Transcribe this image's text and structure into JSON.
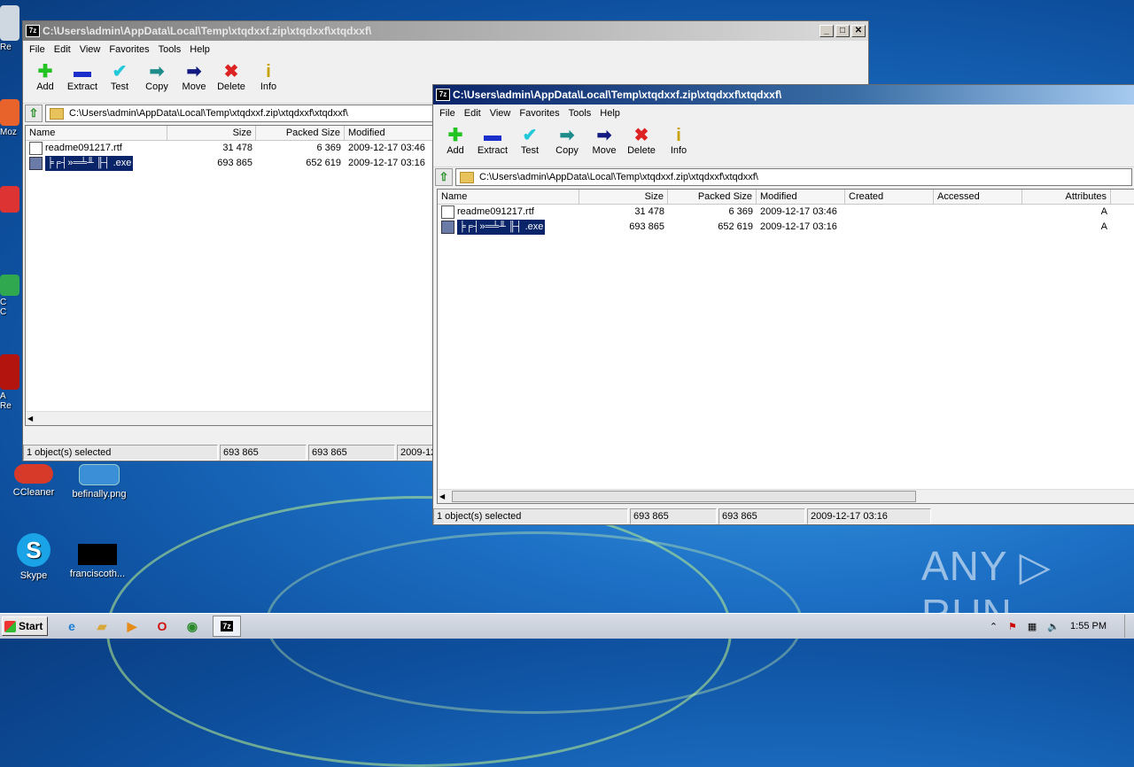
{
  "desktop": {
    "icons": [
      {
        "label": "CCleaner"
      },
      {
        "label": "befinally.png"
      },
      {
        "label": "Skype"
      },
      {
        "label": "franciscoth..."
      }
    ],
    "side_labels": [
      "Re",
      "Moz",
      "C",
      "C",
      "A",
      "Re"
    ]
  },
  "window_back": {
    "title": "C:\\Users\\admin\\AppData\\Local\\Temp\\xtqdxxf.zip\\xtqdxxf\\xtqdxxf\\",
    "app_icon": "7z",
    "controls": {
      "minimize": "_",
      "maximize": "□",
      "close": "✕"
    },
    "menu": [
      "File",
      "Edit",
      "View",
      "Favorites",
      "Tools",
      "Help"
    ],
    "toolbar": [
      "Add",
      "Extract",
      "Test",
      "Copy",
      "Move",
      "Delete",
      "Info"
    ],
    "address": "C:\\Users\\admin\\AppData\\Local\\Temp\\xtqdxxf.zip\\xtqdxxf\\xtqdxxf\\",
    "columns": [
      "Name",
      "Size",
      "Packed Size",
      "Modified"
    ],
    "rows": [
      {
        "name": "readme091217.rtf",
        "size": "31 478",
        "packed": "6 369",
        "modified": "2009-12-17 03:46"
      },
      {
        "name": "╞╒┤»═╧╨ ╟┤ .exe",
        "size": "693 865",
        "packed": "652 619",
        "modified": "2009-12-17 03:16"
      }
    ],
    "status": [
      "1 object(s) selected",
      "693 865",
      "693 865",
      "2009-12-17 03:16"
    ]
  },
  "window_front": {
    "title": "C:\\Users\\admin\\AppData\\Local\\Temp\\xtqdxxf.zip\\xtqdxxf\\xtqdxxf\\",
    "app_icon": "7z",
    "menu": [
      "File",
      "Edit",
      "View",
      "Favorites",
      "Tools",
      "Help"
    ],
    "toolbar": [
      "Add",
      "Extract",
      "Test",
      "Copy",
      "Move",
      "Delete",
      "Info"
    ],
    "address": "C:\\Users\\admin\\AppData\\Local\\Temp\\xtqdxxf.zip\\xtqdxxf\\xtqdxxf\\",
    "columns": [
      "Name",
      "Size",
      "Packed Size",
      "Modified",
      "Created",
      "Accessed",
      "Attributes"
    ],
    "rows": [
      {
        "name": "readme091217.rtf",
        "size": "31 478",
        "packed": "6 369",
        "modified": "2009-12-17 03:46",
        "created": "",
        "accessed": "",
        "attributes": "A"
      },
      {
        "name": "╞╒┤»═╧╨ ╟┤ .exe",
        "size": "693 865",
        "packed": "652 619",
        "modified": "2009-12-17 03:16",
        "created": "",
        "accessed": "",
        "attributes": "A"
      }
    ],
    "status": [
      "1 object(s) selected",
      "693 865",
      "693 865",
      "2009-12-17 03:16"
    ]
  },
  "taskbar": {
    "start_label": "Start",
    "active_app": "7z",
    "clock": "1:55 PM"
  },
  "watermark": "ANY ▷ RUN",
  "colors": {
    "title_active": "#0a246a",
    "selection": "#0a246a",
    "add": "#22c322",
    "delete": "#dd2222",
    "extract": "#1a2ecc",
    "test": "#20c8d8"
  }
}
